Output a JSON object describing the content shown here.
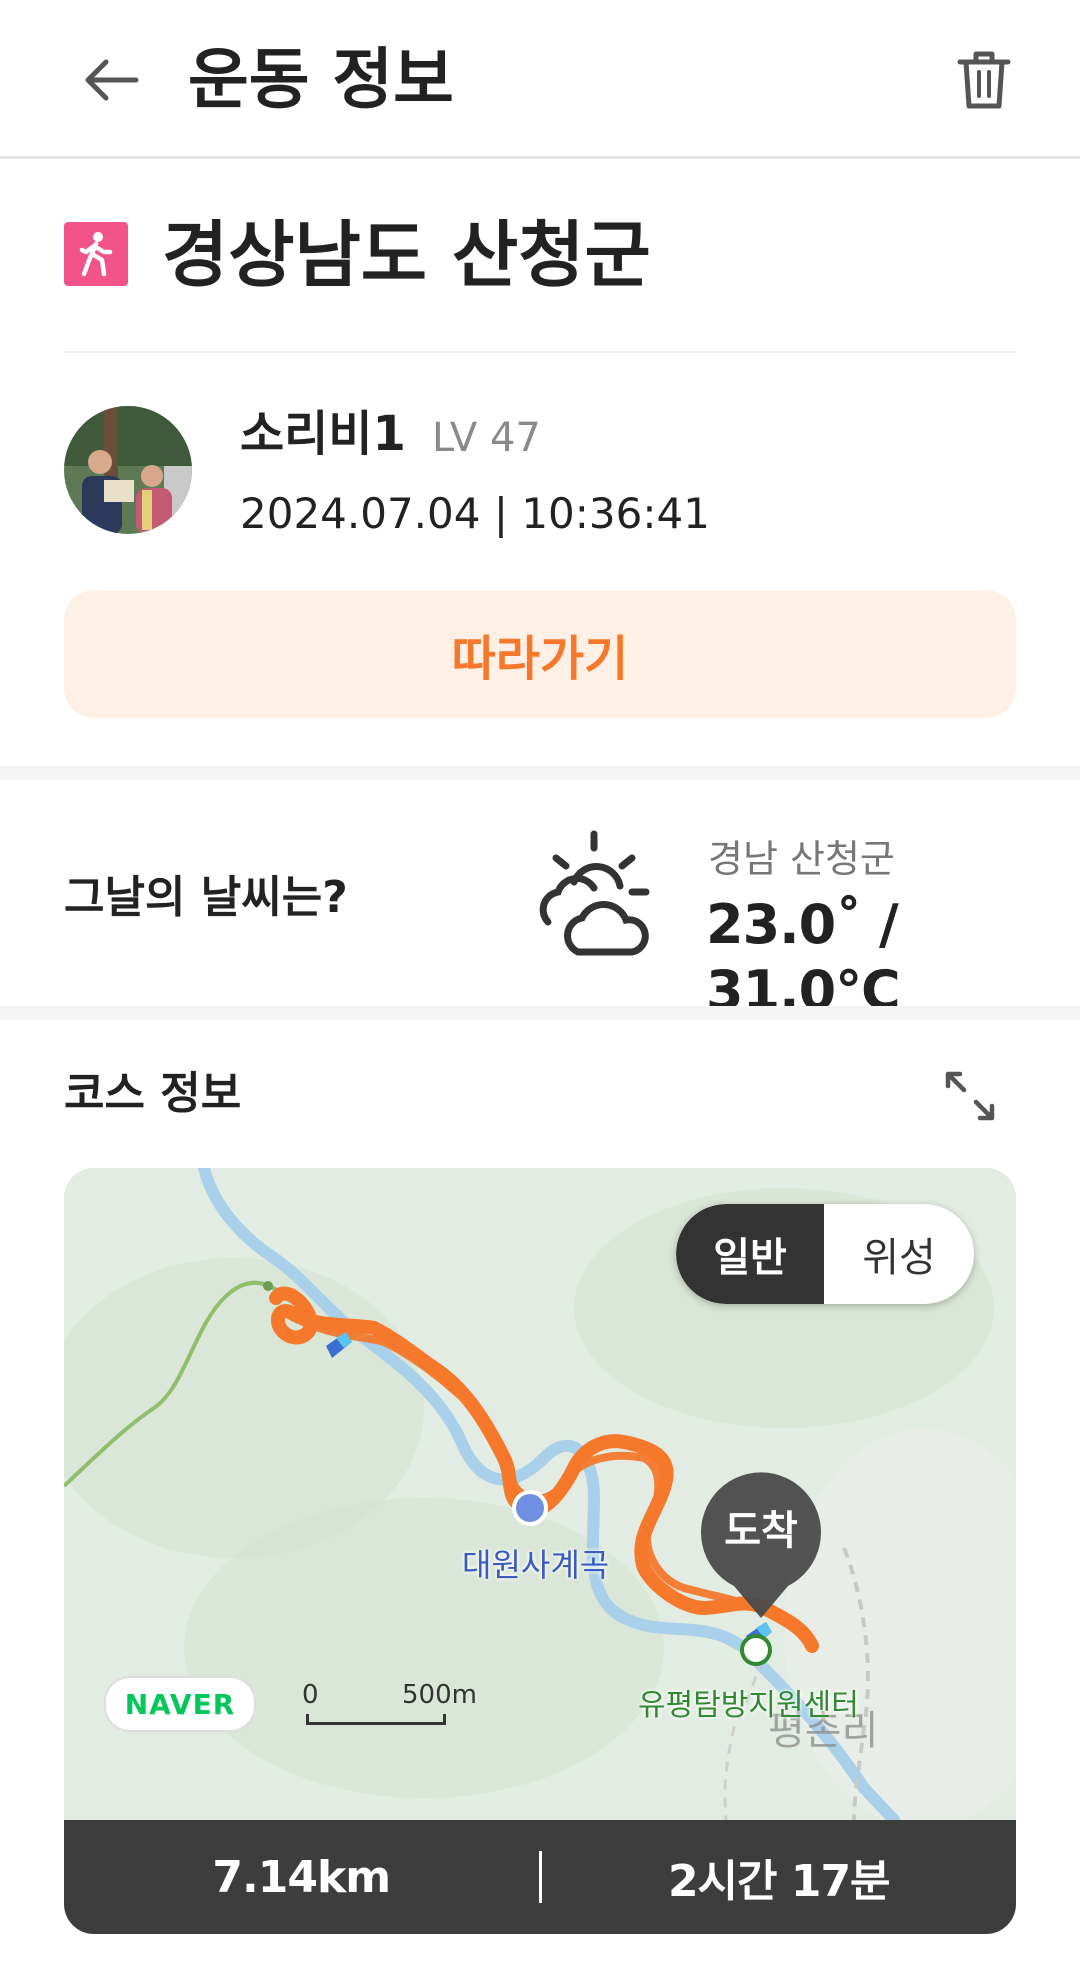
{
  "header": {
    "title": "운동 정보"
  },
  "activity": {
    "location": "경상남도 산청군",
    "badge_icon": "walking-icon"
  },
  "profile": {
    "name": "소리비1",
    "level": "LV 47",
    "datetime": "2024.07.04 | 10:36:41"
  },
  "follow_button": {
    "label": "따라가기"
  },
  "weather": {
    "question": "그날의 날씨는?",
    "icon": "partly-cloudy-icon",
    "place": "경남 산청군",
    "temperature": "23.0˚ / 31.0℃"
  },
  "course": {
    "title": "코스 정보",
    "map": {
      "mode_toggle": {
        "selected": "일반",
        "other": "위성"
      },
      "labels": {
        "valley": "대원사계곡",
        "center": "유평탐방지원센터",
        "village": "평촌리"
      },
      "arrival_marker": "도착",
      "provider": "NAVER",
      "scale": {
        "zero": "0",
        "length": "500m"
      }
    },
    "stats": {
      "distance": "7.14km",
      "duration": "2시간 17분"
    }
  },
  "colors": {
    "accent": "#f5782b",
    "accent_bg": "#fff0e6",
    "walk_badge": "#f2548a",
    "route": "#f5782b",
    "stats_bg": "#3d3d3d"
  }
}
